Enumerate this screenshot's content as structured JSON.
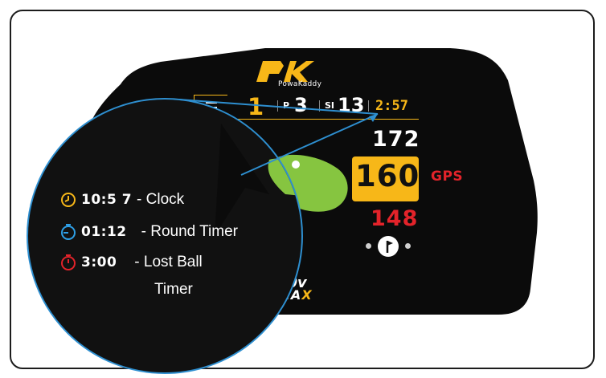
{
  "brand": {
    "logo_mark": "PK",
    "logo_text": "PowaKaddy",
    "model_line1": "30v",
    "model_line2_main": "MA",
    "model_line2_accent": "X"
  },
  "header": {
    "hole": "1",
    "par_label": "P",
    "par_value": "3",
    "si_label": "SI",
    "si_value": "13",
    "timer": "2:57"
  },
  "distances": {
    "back": "172",
    "middle": "160",
    "front": "148",
    "mode": "GPS"
  },
  "legend": [
    {
      "icon": "clock-icon",
      "time": "10:5 7",
      "label": "- Clock",
      "color": "#f7b718"
    },
    {
      "icon": "stopwatch-icon",
      "time": "01:12",
      "label": "- Round Timer",
      "color": "#2e9fe6"
    },
    {
      "icon": "lost-ball-timer-icon",
      "time": "3:00",
      "label": "- Lost Ball",
      "label2": "Timer",
      "color": "#e3232a"
    }
  ],
  "colors": {
    "accent_gold": "#f7b718",
    "accent_red": "#e3232a",
    "accent_blue": "#2e8fd0",
    "green": "#86c540"
  }
}
